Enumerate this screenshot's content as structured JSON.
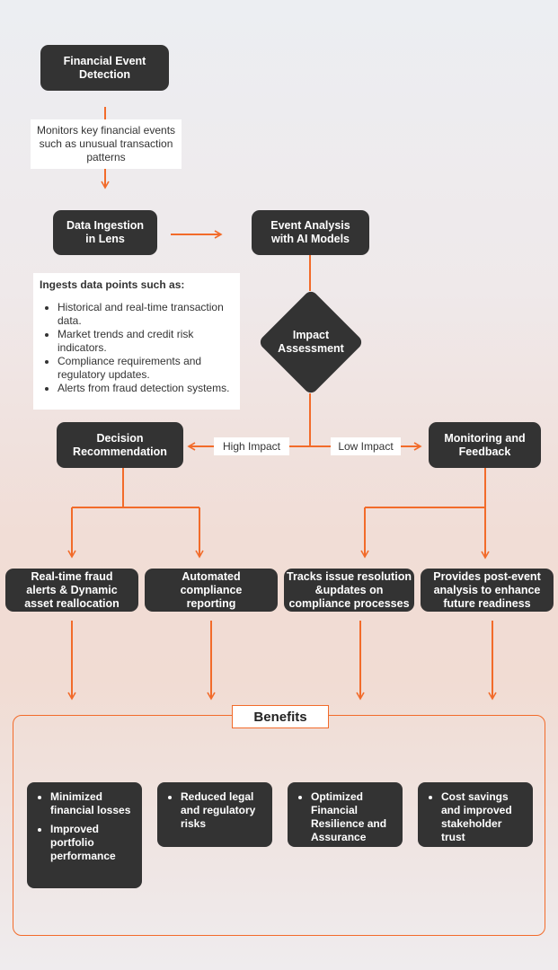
{
  "colors": {
    "accent": "#f26b2a",
    "node": "#333333",
    "label_bg": "#ffffff"
  },
  "nodes": {
    "financial_event_detection": "Financial Event\nDetection",
    "data_ingestion": "Data Ingestion\nin Lens",
    "event_analysis": "Event Analysis\nwith AI Models",
    "impact_assessment": "Impact\nAssessment",
    "decision_recommendation": "Decision\nRecommendation",
    "monitoring_feedback": "Monitoring and\nFeedback"
  },
  "labels": {
    "monitors": "Monitors key financial events\nsuch as unusual transaction\npatterns",
    "high_impact": "High Impact",
    "low_impact": "Low Impact"
  },
  "ingest": {
    "heading": "Ingests data points such as:",
    "items": [
      "Historical and real-time transaction data.",
      "Market trends and credit risk indicators.",
      "Compliance requirements and regulatory updates.",
      "Alerts from fraud detection systems."
    ]
  },
  "outcomes": [
    "Real-time fraud\nalerts & Dynamic\nasset reallocation",
    "Automated\ncompliance\nreporting",
    "Tracks issue resolution\n&updates on\ncompliance processes",
    "Provides post-event\nanalysis to enhance\nfuture readiness"
  ],
  "benefits": {
    "title": "Benefits",
    "cards": [
      [
        "Minimized financial losses",
        "Improved portfolio performance"
      ],
      [
        "Reduced legal and regulatory risks"
      ],
      [
        "Optimized Financial Resilience and Assurance"
      ],
      [
        "Cost savings and improved stakeholder trust"
      ]
    ]
  }
}
